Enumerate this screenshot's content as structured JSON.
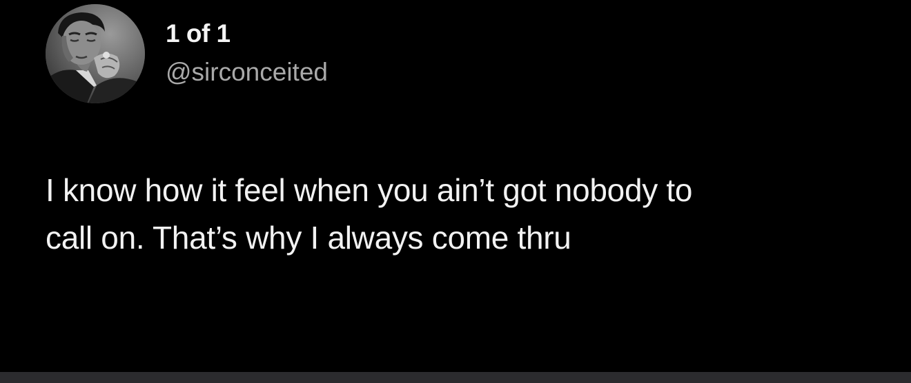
{
  "tweet": {
    "display_name": "1 of 1",
    "handle": "@sirconceited",
    "avatar_icon": "profile-photo",
    "text_lines": [
      "I know how it feel when you ain’t got nobody to",
      "call on. That’s why I always come thru"
    ]
  },
  "colors": {
    "background": "#000000",
    "text": "#f2f2f2",
    "handle": "#a9a9a9",
    "bottom_bar": "#2b2b2e"
  }
}
